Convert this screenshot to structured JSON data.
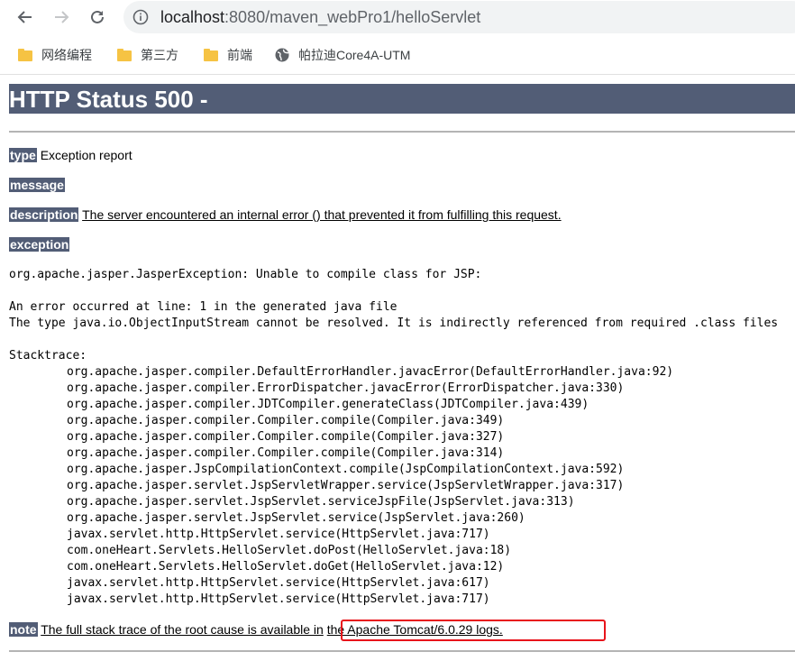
{
  "browser": {
    "url_host": "localhost",
    "url_rest": ":8080/maven_webPro1/helloServlet",
    "bookmarks": [
      {
        "label": "网络编程",
        "icon": "folder-icon"
      },
      {
        "label": "第三方",
        "icon": "folder-icon"
      },
      {
        "label": "前端",
        "icon": "folder-icon"
      },
      {
        "label": "帕拉迪Core4A-UTM",
        "icon": "globe-icon"
      }
    ]
  },
  "page": {
    "title": "HTTP Status 500 -",
    "type_label": "type",
    "type_value": "Exception report",
    "message_label": "message",
    "description_label": "description",
    "description_value": "The server encountered an internal error () that prevented it from fulfilling this request.",
    "exception_label": "exception",
    "exception_line": "org.apache.jasper.JasperException: Unable to compile class for JSP:",
    "error_line1": "An error occurred at line: 1 in the generated java file",
    "error_line2": "The type java.io.ObjectInputStream cannot be resolved. It is indirectly referenced from required .class files",
    "stacktrace_label": "Stacktrace:",
    "stacktrace": [
      "org.apache.jasper.compiler.DefaultErrorHandler.javacError(DefaultErrorHandler.java:92)",
      "org.apache.jasper.compiler.ErrorDispatcher.javacError(ErrorDispatcher.java:330)",
      "org.apache.jasper.compiler.JDTCompiler.generateClass(JDTCompiler.java:439)",
      "org.apache.jasper.compiler.Compiler.compile(Compiler.java:349)",
      "org.apache.jasper.compiler.Compiler.compile(Compiler.java:327)",
      "org.apache.jasper.compiler.Compiler.compile(Compiler.java:314)",
      "org.apache.jasper.JspCompilationContext.compile(JspCompilationContext.java:592)",
      "org.apache.jasper.servlet.JspServletWrapper.service(JspServletWrapper.java:317)",
      "org.apache.jasper.servlet.JspServlet.serviceJspFile(JspServlet.java:313)",
      "org.apache.jasper.servlet.JspServlet.service(JspServlet.java:260)",
      "javax.servlet.http.HttpServlet.service(HttpServlet.java:717)",
      "com.oneHeart.Servlets.HelloServlet.doPost(HelloServlet.java:18)",
      "com.oneHeart.Servlets.HelloServlet.doGet(HelloServlet.java:12)",
      "javax.servlet.http.HttpServlet.service(HttpServlet.java:617)",
      "javax.servlet.http.HttpServlet.service(HttpServlet.java:717)"
    ],
    "note_label": "note",
    "note_value": "The full stack trace of the root cause is available in",
    "note_link": "the Apache Tomcat/6.0.29 logs."
  },
  "colors": {
    "label_bg": "#525d76",
    "highlight_border": "#e8141b"
  }
}
